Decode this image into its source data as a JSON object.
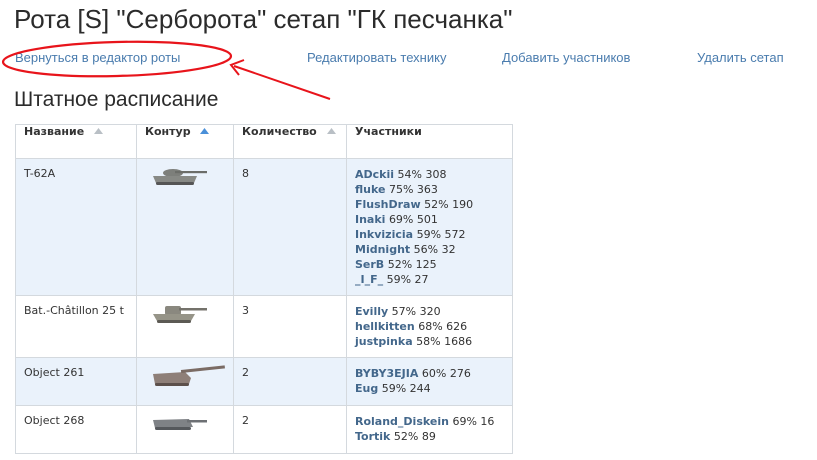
{
  "page_title": "Рота [S] \"Серборота\" сетап \"ГК песчанка\"",
  "nav": {
    "back_to_editor": "Вернуться в редактор роты",
    "edit_vehicles": "Редактировать технику",
    "add_members": "Добавить участников",
    "delete_setup": "Удалить сетап"
  },
  "annotation": {
    "color": "#e8141b",
    "icon": "red-circle-and-arrow"
  },
  "section_title": "Штатное расписание",
  "table": {
    "columns": {
      "name": "Название",
      "contour": "Контур",
      "count": "Количество",
      "members": "Участники"
    },
    "rows": [
      {
        "name": "T-62A",
        "count": "8",
        "members": [
          {
            "name": "ADckii",
            "stats": "54% 308"
          },
          {
            "name": "fluke",
            "stats": "75% 363"
          },
          {
            "name": "FlushDraw",
            "stats": "52% 190"
          },
          {
            "name": "Inaki",
            "stats": "69% 501"
          },
          {
            "name": "Inkvizicia",
            "stats": "59% 572"
          },
          {
            "name": "Midnight",
            "stats": "56% 32"
          },
          {
            "name": "SerB",
            "stats": "52% 125"
          },
          {
            "name": "_I_F_",
            "stats": "59% 27"
          }
        ]
      },
      {
        "name": "Bat.-Châtillon 25 t",
        "count": "3",
        "members": [
          {
            "name": "Evilly",
            "stats": "57% 320"
          },
          {
            "name": "hellkitten",
            "stats": "68% 626"
          },
          {
            "name": "justpinka",
            "stats": "58% 1686"
          }
        ]
      },
      {
        "name": "Object 261",
        "count": "2",
        "members": [
          {
            "name": "BYBY3EJIA",
            "stats": "60% 276"
          },
          {
            "name": "Eug",
            "stats": "59% 244"
          }
        ]
      },
      {
        "name": "Object 268",
        "count": "2",
        "members": [
          {
            "name": "Roland_Diskein",
            "stats": "69% 16"
          },
          {
            "name": "Tortik",
            "stats": "52% 89"
          }
        ]
      }
    ]
  },
  "colors": {
    "link": "#4a7cae",
    "member": "#43678b",
    "row_alt": "#eaf2fb",
    "sort_active": "#4a90d9"
  }
}
